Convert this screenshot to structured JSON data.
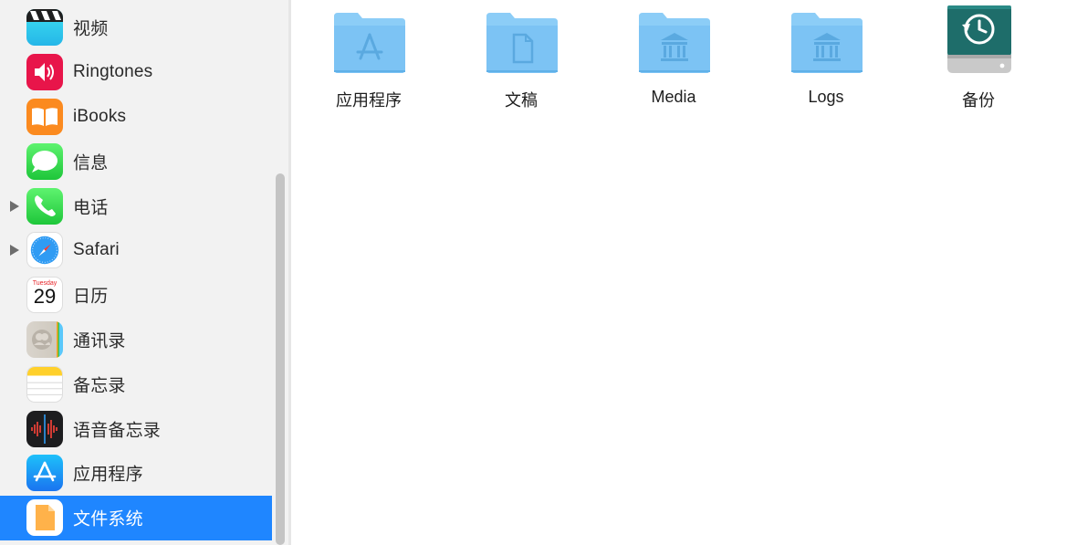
{
  "sidebar": {
    "items": [
      {
        "label": "视频",
        "icon": "clapperboard-icon",
        "has_disclosure": false
      },
      {
        "label": "Ringtones",
        "icon": "speaker-icon",
        "has_disclosure": false
      },
      {
        "label": "iBooks",
        "icon": "open-book-icon",
        "has_disclosure": false
      },
      {
        "label": "信息",
        "icon": "speech-bubble-icon",
        "has_disclosure": false
      },
      {
        "label": "电话",
        "icon": "phone-icon",
        "has_disclosure": true
      },
      {
        "label": "Safari",
        "icon": "compass-icon",
        "has_disclosure": true
      },
      {
        "label": "日历",
        "icon": "calendar-icon",
        "has_disclosure": false,
        "calendar_day_name": "Tuesday",
        "calendar_date": "29"
      },
      {
        "label": "通讯录",
        "icon": "contacts-icon",
        "has_disclosure": false
      },
      {
        "label": "备忘录",
        "icon": "notes-icon",
        "has_disclosure": false
      },
      {
        "label": "语音备忘录",
        "icon": "waveform-icon",
        "has_disclosure": false
      },
      {
        "label": "应用程序",
        "icon": "app-store-icon",
        "has_disclosure": false
      },
      {
        "label": "文件系统",
        "icon": "document-icon",
        "has_disclosure": false,
        "selected": true
      }
    ]
  },
  "files": [
    {
      "label": "应用程序",
      "icon": "applications-folder-icon"
    },
    {
      "label": "文稿",
      "icon": "documents-folder-icon"
    },
    {
      "label": "Media",
      "icon": "library-folder-icon"
    },
    {
      "label": "Logs",
      "icon": "library-folder-icon"
    },
    {
      "label": "备份",
      "icon": "time-machine-drive-icon"
    }
  ],
  "colors": {
    "selection": "#1f86ff",
    "folder": "#7cc3f4",
    "time_machine": "#1e6d6a"
  }
}
